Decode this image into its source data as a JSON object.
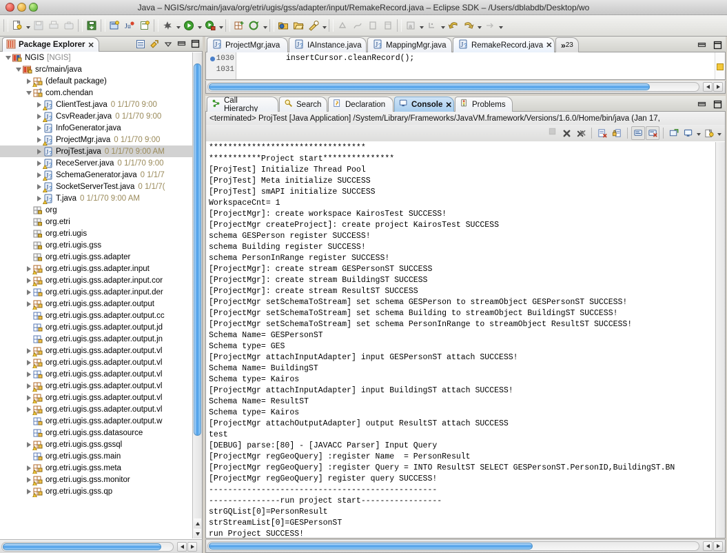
{
  "window": {
    "title": "Java – NGIS/src/main/java/org/etri/ugis/gss/adapter/input/RemakeRecord.java – Eclipse SDK – /Users/dblabdb/Desktop/wo"
  },
  "toolbar": {
    "groups": [
      {
        "items": [
          {
            "name": "new-wizard-icon",
            "kind": "new",
            "arrow": true
          },
          {
            "name": "save-icon",
            "kind": "save-disabled",
            "arrow": false
          },
          {
            "name": "print-icon",
            "kind": "print-disabled",
            "arrow": false
          },
          {
            "name": "export-icon",
            "kind": "export-disabled",
            "arrow": false
          }
        ]
      },
      {
        "items": [
          {
            "name": "save-all-icon",
            "kind": "save-all",
            "arrow": false
          }
        ]
      },
      {
        "items": [
          {
            "name": "new-class-icon",
            "kind": "new-class",
            "arrow": false
          },
          {
            "name": "new-junit-test-icon",
            "kind": "junit",
            "arrow": false
          },
          {
            "name": "new-package-icon",
            "kind": "new-package",
            "arrow": false
          }
        ]
      },
      {
        "items": [
          {
            "name": "debug-icon",
            "kind": "debug",
            "arrow": true
          },
          {
            "name": "run-icon",
            "kind": "run",
            "arrow": true
          },
          {
            "name": "external-tools-icon",
            "kind": "ext-tools",
            "arrow": true
          }
        ]
      },
      {
        "items": [
          {
            "name": "new-java-project-icon",
            "kind": "grid-plus",
            "arrow": false
          },
          {
            "name": "search-field-icon",
            "kind": "target",
            "arrow": true
          }
        ]
      },
      {
        "items": [
          {
            "name": "open-type-icon",
            "kind": "folder-blue",
            "arrow": false
          },
          {
            "name": "open-resource-icon",
            "kind": "folder-open",
            "arrow": false
          },
          {
            "name": "quick-fix-icon",
            "kind": "wrench",
            "arrow": true
          }
        ]
      },
      {
        "items": [
          {
            "name": "next-annotation-icon",
            "kind": "annot-disabled",
            "arrow": false
          },
          {
            "name": "prev-annotation-icon",
            "kind": "annot2-disabled",
            "arrow": false
          },
          {
            "name": "last-edit-icon",
            "kind": "box-disabled",
            "arrow": false
          },
          {
            "name": "pin-editor-icon",
            "kind": "box2-disabled",
            "arrow": false
          }
        ]
      },
      {
        "items": [
          {
            "name": "toggle-mark-occurrences-icon",
            "kind": "mark-occ",
            "arrow": true
          },
          {
            "name": "show-whitespace-icon",
            "kind": "whitespace",
            "arrow": true
          },
          {
            "name": "back-icon",
            "kind": "back-arrow",
            "arrow": false
          },
          {
            "name": "forward-icon",
            "kind": "forward-arrow",
            "arrow": true
          },
          {
            "name": "previous-edit-icon",
            "kind": "prev-edit-disabled",
            "arrow": true
          }
        ]
      }
    ]
  },
  "package_explorer": {
    "tab_label": "Package Explorer",
    "tab_icon": "package-explorer-icon",
    "close_glyph": "✕",
    "tools": [
      {
        "name": "collapse-all-icon",
        "glyph": "collapse-all"
      },
      {
        "name": "link-with-editor-icon",
        "glyph": "link"
      },
      {
        "name": "view-menu-icon",
        "glyph": "chevron-down"
      },
      {
        "name": "minimize-view-icon",
        "glyph": "minimize"
      },
      {
        "name": "maximize-view-icon",
        "glyph": "maximize"
      }
    ],
    "tree": [
      {
        "indent": 0,
        "twisty": "open",
        "icon": "java-project-icon",
        "label": "NGIS",
        "dim": "[NGIS]",
        "meta": ""
      },
      {
        "indent": 1,
        "twisty": "open",
        "icon": "source-folder-icon",
        "label": "src/main/java",
        "dim": "",
        "meta": ""
      },
      {
        "indent": 2,
        "twisty": "closed",
        "icon": "package-warn-icon",
        "label": "(default package)",
        "dim": "",
        "meta": ""
      },
      {
        "indent": 2,
        "twisty": "open",
        "icon": "package-q-icon",
        "label": "com.chendan",
        "dim": "",
        "meta": ""
      },
      {
        "indent": 3,
        "twisty": "closed",
        "icon": "java-file-warn-icon",
        "label": "ClientTest.java",
        "dim": "",
        "meta": "0  1/1/70 9:00"
      },
      {
        "indent": 3,
        "twisty": "closed",
        "icon": "java-file-warn-icon",
        "label": "CsvReader.java",
        "dim": "",
        "meta": "0  1/1/70 9:00"
      },
      {
        "indent": 3,
        "twisty": "closed",
        "icon": "java-file-icon",
        "label": "InfoGenerator.java",
        "dim": "",
        "meta": ""
      },
      {
        "indent": 3,
        "twisty": "closed",
        "icon": "java-file-warn-icon",
        "label": "ProjectMgr.java",
        "dim": "",
        "meta": "0  1/1/70 9:00"
      },
      {
        "indent": 3,
        "twisty": "closed",
        "icon": "java-file-icon",
        "label": "ProjTest.java",
        "dim": "",
        "meta": "0  1/1/70 9:00 AM",
        "selected": true
      },
      {
        "indent": 3,
        "twisty": "closed",
        "icon": "java-file-warn-icon",
        "label": "ReceServer.java",
        "dim": "",
        "meta": "0  1/1/70 9:00"
      },
      {
        "indent": 3,
        "twisty": "closed",
        "icon": "java-file-warn-icon",
        "label": "SchemaGenerator.java",
        "dim": "",
        "meta": "0  1/1/7"
      },
      {
        "indent": 3,
        "twisty": "closed",
        "icon": "java-file-warn-icon",
        "label": "SocketServerTest.java",
        "dim": "",
        "meta": "0  1/1/7("
      },
      {
        "indent": 3,
        "twisty": "closed",
        "icon": "java-file-warn-icon",
        "label": "T.java",
        "dim": "",
        "meta": "0  1/1/70 9:00 AM"
      },
      {
        "indent": 2,
        "twisty": "none",
        "icon": "package-empty-icon",
        "label": "org",
        "dim": "",
        "meta": ""
      },
      {
        "indent": 2,
        "twisty": "none",
        "icon": "package-empty-icon",
        "label": "org.etri",
        "dim": "",
        "meta": ""
      },
      {
        "indent": 2,
        "twisty": "none",
        "icon": "package-empty-icon",
        "label": "org.etri.ugis",
        "dim": "",
        "meta": ""
      },
      {
        "indent": 2,
        "twisty": "none",
        "icon": "package-empty-icon",
        "label": "org.etri.ugis.gss",
        "dim": "",
        "meta": ""
      },
      {
        "indent": 2,
        "twisty": "none",
        "icon": "package-empty-icon",
        "label": "org.etri.ugis.gss.adapter",
        "dim": "",
        "meta": ""
      },
      {
        "indent": 2,
        "twisty": "closed",
        "icon": "package-warn-icon",
        "label": "org.etri.ugis.gss.adapter.input",
        "dim": "",
        "meta": ""
      },
      {
        "indent": 2,
        "twisty": "closed",
        "icon": "package-warn-icon",
        "label": "org.etri.ugis.gss.adapter.input.cor",
        "dim": "",
        "meta": ""
      },
      {
        "indent": 2,
        "twisty": "closed",
        "icon": "package-icon",
        "label": "org.etri.ugis.gss.adapter.input.der",
        "dim": "",
        "meta": ""
      },
      {
        "indent": 2,
        "twisty": "closed",
        "icon": "package-warn-icon",
        "label": "org.etri.ugis.gss.adapter.output",
        "dim": "",
        "meta": ""
      },
      {
        "indent": 2,
        "twisty": "none",
        "icon": "package-icon",
        "label": "org.etri.ugis.gss.adapter.output.cc",
        "dim": "",
        "meta": ""
      },
      {
        "indent": 2,
        "twisty": "none",
        "icon": "package-icon",
        "label": "org.etri.ugis.gss.adapter.output.jd",
        "dim": "",
        "meta": ""
      },
      {
        "indent": 2,
        "twisty": "none",
        "icon": "package-icon",
        "label": "org.etri.ugis.gss.adapter.output.jn",
        "dim": "",
        "meta": ""
      },
      {
        "indent": 2,
        "twisty": "closed",
        "icon": "package-warn-icon",
        "label": "org.etri.ugis.gss.adapter.output.vl",
        "dim": "",
        "meta": ""
      },
      {
        "indent": 2,
        "twisty": "closed",
        "icon": "package-warn-icon",
        "label": "org.etri.ugis.gss.adapter.output.vl",
        "dim": "",
        "meta": ""
      },
      {
        "indent": 2,
        "twisty": "closed",
        "icon": "package-icon",
        "label": "org.etri.ugis.gss.adapter.output.vl",
        "dim": "",
        "meta": ""
      },
      {
        "indent": 2,
        "twisty": "closed",
        "icon": "package-warn-icon",
        "label": "org.etri.ugis.gss.adapter.output.vl",
        "dim": "",
        "meta": ""
      },
      {
        "indent": 2,
        "twisty": "closed",
        "icon": "package-warn-icon",
        "label": "org.etri.ugis.gss.adapter.output.vl",
        "dim": "",
        "meta": ""
      },
      {
        "indent": 2,
        "twisty": "closed",
        "icon": "package-warn-icon",
        "label": "org.etri.ugis.gss.adapter.output.vl",
        "dim": "",
        "meta": ""
      },
      {
        "indent": 2,
        "twisty": "none",
        "icon": "package-icon",
        "label": "org.etri.ugis.gss.adapter.output.w",
        "dim": "",
        "meta": ""
      },
      {
        "indent": 2,
        "twisty": "none",
        "icon": "package-icon",
        "label": "org.etri.ugis.gss.datasource",
        "dim": "",
        "meta": ""
      },
      {
        "indent": 2,
        "twisty": "closed",
        "icon": "package-warn-icon",
        "label": "org.etri.ugis.gss.gssql",
        "dim": "",
        "meta": ""
      },
      {
        "indent": 2,
        "twisty": "none",
        "icon": "package-icon",
        "label": "org.etri.ugis.gss.main",
        "dim": "",
        "meta": ""
      },
      {
        "indent": 2,
        "twisty": "closed",
        "icon": "package-warn-icon",
        "label": "org.etri.ugis.gss.meta",
        "dim": "",
        "meta": ""
      },
      {
        "indent": 2,
        "twisty": "closed",
        "icon": "package-warn-icon",
        "label": "org.etri.ugis.gss.monitor",
        "dim": "",
        "meta": ""
      },
      {
        "indent": 2,
        "twisty": "closed",
        "icon": "package-warn-icon",
        "label": "org.etri.ugis.gss.qp",
        "dim": "",
        "meta": ""
      }
    ]
  },
  "editor": {
    "tabs": [
      {
        "label": "ProjectMgr.java",
        "icon": "java-file-icon",
        "active": false,
        "closable": false
      },
      {
        "label": "IAInstance.java",
        "icon": "java-file-icon",
        "active": false,
        "closable": false
      },
      {
        "label": "MappingMgr.java",
        "icon": "java-file-icon",
        "active": false,
        "closable": false
      },
      {
        "label": "RemakeRecord.java",
        "icon": "java-file-icon",
        "active": true,
        "closable": true
      }
    ],
    "close_glyph": "✕",
    "overflow": {
      "chevron": "»",
      "count": "23"
    },
    "tools": [
      {
        "name": "minimize-editor-icon",
        "glyph": "minimize"
      },
      {
        "name": "maximize-editor-icon",
        "glyph": "maximize"
      }
    ],
    "lines": [
      {
        "number": "1030",
        "breakpoint": true,
        "text": "    insertCursor.cleanRecord();"
      },
      {
        "number": "1031",
        "breakpoint": false,
        "text": ""
      }
    ]
  },
  "console": {
    "tabs": [
      {
        "label": "Call Hierarchy",
        "icon": "call-hierarchy-icon",
        "active": false,
        "closable": false
      },
      {
        "label": "Search",
        "icon": "search-icon",
        "active": false,
        "closable": false
      },
      {
        "label": "Declaration",
        "icon": "declaration-icon",
        "active": false,
        "closable": false
      },
      {
        "label": "Console",
        "icon": "console-icon",
        "active": true,
        "closable": true
      },
      {
        "label": "Problems",
        "icon": "problems-icon",
        "active": false,
        "closable": false
      }
    ],
    "close_glyph": "✕",
    "header": "<terminated> ProjTest [Java Application] /System/Library/Frameworks/JavaVM.framework/Versions/1.6.0/Home/bin/java (Jan 17,",
    "tools": [
      {
        "name": "terminate-icon",
        "glyph": "stop-disabled",
        "framed": false,
        "arrow": false
      },
      {
        "name": "remove-launch-icon",
        "glyph": "x-gray",
        "framed": false,
        "arrow": false
      },
      {
        "name": "remove-all-launches-icon",
        "glyph": "xx-gray",
        "framed": false,
        "arrow": false
      },
      {
        "name": "clear-console-icon",
        "glyph": "clear",
        "framed": false,
        "arrow": false
      },
      {
        "name": "scroll-lock-icon",
        "glyph": "lock",
        "framed": false,
        "arrow": false
      },
      {
        "name": "pin-console-icon",
        "glyph": "pin",
        "framed": true,
        "arrow": false
      },
      {
        "name": "display-selected-console-icon",
        "glyph": "display",
        "framed": true,
        "arrow": false
      },
      {
        "name": "open-console-icon",
        "glyph": "open-console",
        "framed": false,
        "arrow": false
      },
      {
        "name": "select-console-icon",
        "glyph": "monitor",
        "framed": false,
        "arrow": true
      },
      {
        "name": "new-console-view-icon",
        "glyph": "new-view",
        "framed": false,
        "arrow": true
      }
    ],
    "output": [
      "*********************************",
      "***********Project start***************",
      "[ProjTest] Initialize Thread Pool",
      "[ProjTest] Meta initialize SUCCESS",
      "[ProjTest] smAPI initialize SUCCESS",
      "WorkspaceCnt= 1",
      "[ProjectMgr]: create workspace KairosTest SUCCESS!",
      "[ProjectMgr createProject]: create project KairosTest SUCCESS",
      "schema GESPerson register SUCCESS!",
      "schema Building register SUCCESS!",
      "schema PersonInRange register SUCCESS!",
      "[ProjectMgr]: create stream GESPersonST SUCCESS",
      "[ProjectMgr]: create stream BuildingST SUCCESS",
      "[ProjectMgr]: create stream ResultST SUCCESS",
      "[ProjectMgr setSchemaToStream] set schema GESPerson to streamObject GESPersonST SUCCESS!",
      "[ProjectMgr setSchemaToStream] set schema Building to streamObject BuildingST SUCCESS!",
      "[ProjectMgr setSchemaToStream] set schema PersonInRange to streamObject ResultST SUCCESS!",
      "Schema Name= GESPersonST",
      "Schema type= GES",
      "[ProjectMgr attachInputAdapter] input GESPersonST attach SUCCESS!",
      "Schema Name= BuildingST",
      "Schema type= Kairos",
      "[ProjectMgr attachInputAdapter] input BuildingST attach SUCCESS!",
      "Schema Name= ResultST",
      "Schema type= Kairos",
      "[ProjectMgr attachOutputAdapter] output ResultST attach SUCCESS",
      "test",
      "[DEBUG] parse:[80] - [JAVACC Parser] Input Query",
      "[ProjectMgr regGeoQuery] :register Name  = PersonResult",
      "[ProjectMgr regGeoQuery] :register Query = INTO ResultST SELECT GESPersonST.PersonID,BuildingST.BN",
      "[ProjectMgr regGeoQuery] register query SUCCESS!",
      "------------------------------------------------",
      "---------------run project start-----------------",
      "strGQList[0]=PersonResult",
      "strStreamList[0]=GESPersonST",
      "run Project SUCCESS!"
    ]
  },
  "colors": {
    "accent_blue": "#4a9de8",
    "tab_active": "#a8cdee",
    "tree_selection": "#d2d2d2",
    "meta_text": "#9a8a5a"
  }
}
